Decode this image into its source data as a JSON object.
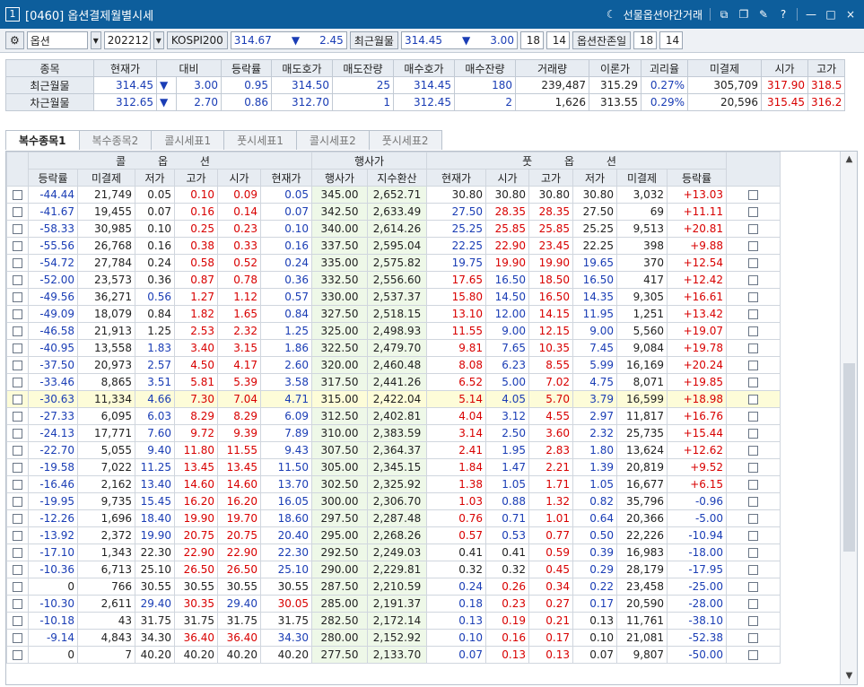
{
  "title": {
    "window_no": "1",
    "text": "[0460] 옵션결제월별시세",
    "night_trade": "선물옵션야간거래"
  },
  "colors": {
    "titlebar": "#0d5e9c",
    "up": "#d80000",
    "down": "#1a3db5"
  },
  "toolbar": {
    "product": "옵션",
    "month": "202212",
    "index_label": "KOSPI200",
    "index_value": "314.67",
    "index_arrow": "▼",
    "index_change": "2.45",
    "near_label": "최근월물",
    "near_value": "314.45",
    "near_arrow": "▼",
    "near_change": "3.00",
    "count1": "18",
    "count2": "14",
    "remain_label": "옵션잔존일",
    "remain1": "18",
    "remain2": "14"
  },
  "summary": {
    "headers": [
      "종목",
      "현재가",
      "대비",
      "등락률",
      "매도호가",
      "매도잔량",
      "매수호가",
      "매수잔량",
      "거래량",
      "이론가",
      "괴리율",
      "미결제",
      "시가",
      "고가"
    ],
    "rows": [
      [
        "최근월물",
        "314.45",
        "▼",
        "3.00",
        "0.95",
        "314.50",
        "25",
        "314.45",
        "180",
        "239,487",
        "315.29",
        "0.27%",
        "305,709",
        "317.90",
        "318.5"
      ],
      [
        "차근월물",
        "312.65",
        "▼",
        "2.70",
        "0.86",
        "312.70",
        "1",
        "312.45",
        "2",
        "1,626",
        "313.55",
        "0.29%",
        "20,596",
        "315.45",
        "316.2"
      ]
    ]
  },
  "tabs": [
    "복수종목1",
    "복수종목2",
    "콜시세표1",
    "풋시세표1",
    "콜시세표2",
    "풋시세표2"
  ],
  "grid": {
    "group_headers": {
      "call": "콜 옵 션",
      "strike": "행사가",
      "put": "풋 옵 션"
    },
    "call_headers": [
      "등락률",
      "미결제",
      "저가",
      "고가",
      "시가",
      "현재가"
    ],
    "strike_headers": [
      "행사가",
      "지수환산"
    ],
    "put_headers": [
      "현재가",
      "시가",
      "고가",
      "저가",
      "미결제",
      "등락률"
    ],
    "rows": [
      [
        "-44.44",
        "21,749",
        "0.05",
        "0.10",
        "0.09",
        "0.05",
        "345.00",
        "2,652.71",
        "30.80",
        "30.80",
        "30.80",
        "30.80",
        "3,032",
        "+13.03"
      ],
      [
        "-41.67",
        "19,455",
        "0.07",
        "0.16",
        "0.14",
        "0.07",
        "342.50",
        "2,633.49",
        "27.50",
        "28.35",
        "28.35",
        "27.50",
        "69",
        "+11.11"
      ],
      [
        "-58.33",
        "30,985",
        "0.10",
        "0.25",
        "0.23",
        "0.10",
        "340.00",
        "2,614.26",
        "25.25",
        "25.85",
        "25.85",
        "25.25",
        "9,513",
        "+20.81"
      ],
      [
        "-55.56",
        "26,768",
        "0.16",
        "0.38",
        "0.33",
        "0.16",
        "337.50",
        "2,595.04",
        "22.25",
        "22.90",
        "23.45",
        "22.25",
        "398",
        "+9.88"
      ],
      [
        "-54.72",
        "27,784",
        "0.24",
        "0.58",
        "0.52",
        "0.24",
        "335.00",
        "2,575.82",
        "19.75",
        "19.90",
        "19.90",
        "19.65",
        "370",
        "+12.54"
      ],
      [
        "-52.00",
        "23,573",
        "0.36",
        "0.87",
        "0.78",
        "0.36",
        "332.50",
        "2,556.60",
        "17.65",
        "16.50",
        "18.50",
        "16.50",
        "417",
        "+12.42"
      ],
      [
        "-49.56",
        "36,271",
        "0.56",
        "1.27",
        "1.12",
        "0.57",
        "330.00",
        "2,537.37",
        "15.80",
        "14.50",
        "16.50",
        "14.35",
        "9,305",
        "+16.61"
      ],
      [
        "-49.09",
        "18,079",
        "0.84",
        "1.82",
        "1.65",
        "0.84",
        "327.50",
        "2,518.15",
        "13.10",
        "12.00",
        "14.15",
        "11.95",
        "1,251",
        "+13.42"
      ],
      [
        "-46.58",
        "21,913",
        "1.25",
        "2.53",
        "2.32",
        "1.25",
        "325.00",
        "2,498.93",
        "11.55",
        "9.00",
        "12.15",
        "9.00",
        "5,560",
        "+19.07"
      ],
      [
        "-40.95",
        "13,558",
        "1.83",
        "3.40",
        "3.15",
        "1.86",
        "322.50",
        "2,479.70",
        "9.81",
        "7.65",
        "10.35",
        "7.45",
        "9,084",
        "+19.78"
      ],
      [
        "-37.50",
        "20,973",
        "2.57",
        "4.50",
        "4.17",
        "2.60",
        "320.00",
        "2,460.48",
        "8.08",
        "6.23",
        "8.55",
        "5.99",
        "16,169",
        "+20.24"
      ],
      [
        "-33.46",
        "8,865",
        "3.51",
        "5.81",
        "5.39",
        "3.58",
        "317.50",
        "2,441.26",
        "6.52",
        "5.00",
        "7.02",
        "4.75",
        "8,071",
        "+19.85"
      ],
      [
        "-30.63",
        "11,334",
        "4.66",
        "7.30",
        "7.04",
        "4.71",
        "315.00",
        "2,422.04",
        "5.14",
        "4.05",
        "5.70",
        "3.79",
        "16,599",
        "+18.98"
      ],
      [
        "-27.33",
        "6,095",
        "6.03",
        "8.29",
        "8.29",
        "6.09",
        "312.50",
        "2,402.81",
        "4.04",
        "3.12",
        "4.55",
        "2.97",
        "11,817",
        "+16.76"
      ],
      [
        "-24.13",
        "17,771",
        "7.60",
        "9.72",
        "9.39",
        "7.89",
        "310.00",
        "2,383.59",
        "3.14",
        "2.50",
        "3.60",
        "2.32",
        "25,735",
        "+15.44"
      ],
      [
        "-22.70",
        "5,055",
        "9.40",
        "11.80",
        "11.55",
        "9.43",
        "307.50",
        "2,364.37",
        "2.41",
        "1.95",
        "2.83",
        "1.80",
        "13,624",
        "+12.62"
      ],
      [
        "-19.58",
        "7,022",
        "11.25",
        "13.45",
        "13.45",
        "11.50",
        "305.00",
        "2,345.15",
        "1.84",
        "1.47",
        "2.21",
        "1.39",
        "20,819",
        "+9.52"
      ],
      [
        "-16.46",
        "2,162",
        "13.40",
        "14.60",
        "14.60",
        "13.70",
        "302.50",
        "2,325.92",
        "1.38",
        "1.05",
        "1.71",
        "1.05",
        "16,677",
        "+6.15"
      ],
      [
        "-19.95",
        "9,735",
        "15.45",
        "16.20",
        "16.20",
        "16.05",
        "300.00",
        "2,306.70",
        "1.03",
        "0.88",
        "1.32",
        "0.82",
        "35,796",
        "-0.96"
      ],
      [
        "-12.26",
        "1,696",
        "18.40",
        "19.90",
        "19.70",
        "18.60",
        "297.50",
        "2,287.48",
        "0.76",
        "0.71",
        "1.01",
        "0.64",
        "20,366",
        "-5.00"
      ],
      [
        "-13.92",
        "2,372",
        "19.90",
        "20.75",
        "20.75",
        "20.40",
        "295.00",
        "2,268.26",
        "0.57",
        "0.53",
        "0.77",
        "0.50",
        "22,226",
        "-10.94"
      ],
      [
        "-17.10",
        "1,343",
        "22.30",
        "22.90",
        "22.90",
        "22.30",
        "292.50",
        "2,249.03",
        "0.41",
        "0.41",
        "0.59",
        "0.39",
        "16,983",
        "-18.00"
      ],
      [
        "-10.36",
        "6,713",
        "25.10",
        "26.50",
        "26.50",
        "25.10",
        "290.00",
        "2,229.81",
        "0.32",
        "0.32",
        "0.45",
        "0.29",
        "28,179",
        "-17.95"
      ],
      [
        "0",
        "766",
        "30.55",
        "30.55",
        "30.55",
        "30.55",
        "287.50",
        "2,210.59",
        "0.24",
        "0.26",
        "0.34",
        "0.22",
        "23,458",
        "-25.00"
      ],
      [
        "-10.30",
        "2,611",
        "29.40",
        "30.35",
        "29.40",
        "30.05",
        "285.00",
        "2,191.37",
        "0.18",
        "0.23",
        "0.27",
        "0.17",
        "20,590",
        "-28.00"
      ],
      [
        "-10.18",
        "43",
        "31.75",
        "31.75",
        "31.75",
        "31.75",
        "282.50",
        "2,172.14",
        "0.13",
        "0.19",
        "0.21",
        "0.13",
        "11,761",
        "-38.10"
      ],
      [
        "-9.14",
        "4,843",
        "34.30",
        "36.40",
        "36.40",
        "34.30",
        "280.00",
        "2,152.92",
        "0.10",
        "0.16",
        "0.17",
        "0.10",
        "21,081",
        "-52.38"
      ],
      [
        "0",
        "7",
        "40.20",
        "40.20",
        "40.20",
        "40.20",
        "277.50",
        "2,133.70",
        "0.07",
        "0.13",
        "0.13",
        "0.07",
        "9,807",
        "-50.00"
      ]
    ]
  }
}
